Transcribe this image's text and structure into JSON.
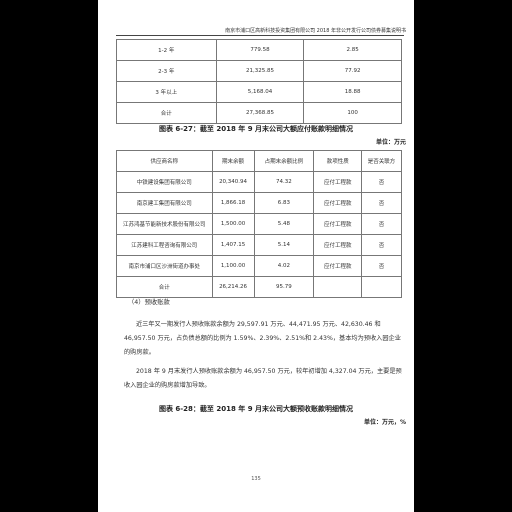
{
  "header": {
    "title": "南京市浦口区高新科技投资集团有限公司 2018 年非公开发行公司债券募集说明书"
  },
  "table1": {
    "rows": [
      [
        "1-2 年",
        "779.58",
        "2.85"
      ],
      [
        "2-3 年",
        "21,325.85",
        "77.92"
      ],
      [
        "3 年以上",
        "5,168.04",
        "18.88"
      ],
      [
        "合计",
        "27,368.85",
        "100"
      ]
    ]
  },
  "caption1": "图表 6-27：截至 2018 年 9 月末公司大额应付账款明细情况",
  "unit1": "单位：万元",
  "table2": {
    "headers": [
      "供应商名称",
      "期末余额",
      "占期末余额比例",
      "款项性质",
      "是否关联方"
    ],
    "rows": [
      [
        "中铁建设集团有限公司",
        "20,340.94",
        "74.32",
        "应付工程款",
        "否"
      ],
      [
        "南京建工集团有限公司",
        "1,866.18",
        "6.83",
        "应付工程款",
        "否"
      ],
      [
        "江苏鸿基节能新技术股份有限公司",
        "1,500.00",
        "5.48",
        "应付工程款",
        "否"
      ],
      [
        "江苏建科工程咨询有限公司",
        "1,407.15",
        "5.14",
        "应付工程款",
        "否"
      ],
      [
        "南京市浦口区沙洲街道办事处",
        "1,100.00",
        "4.02",
        "应付工程款",
        "否"
      ],
      [
        "合计",
        "26,214.26",
        "95.79",
        "",
        ""
      ]
    ]
  },
  "section4": "（4）预收账款",
  "para1": "近三年又一期发行人预收账款余额为 29,597.91 万元、44,471.95 万元、42,630.46 和 46,957.50 万元，占负债总额的比例为 1.59%、2.39%、2.51%和 2.43%，基本均为预收入园企业的购房款。",
  "para2": "2018 年 9 月末发行人预收账款余额为 46,957.50 万元，较年初增加 4,327.04 万元，主要是预收入园企业的购房款增加导致。",
  "caption2": "图表 6-28：截至 2018 年 9 月末公司大额预收账款明细情况",
  "unit2": "单位：万元，%",
  "page_number": "135"
}
